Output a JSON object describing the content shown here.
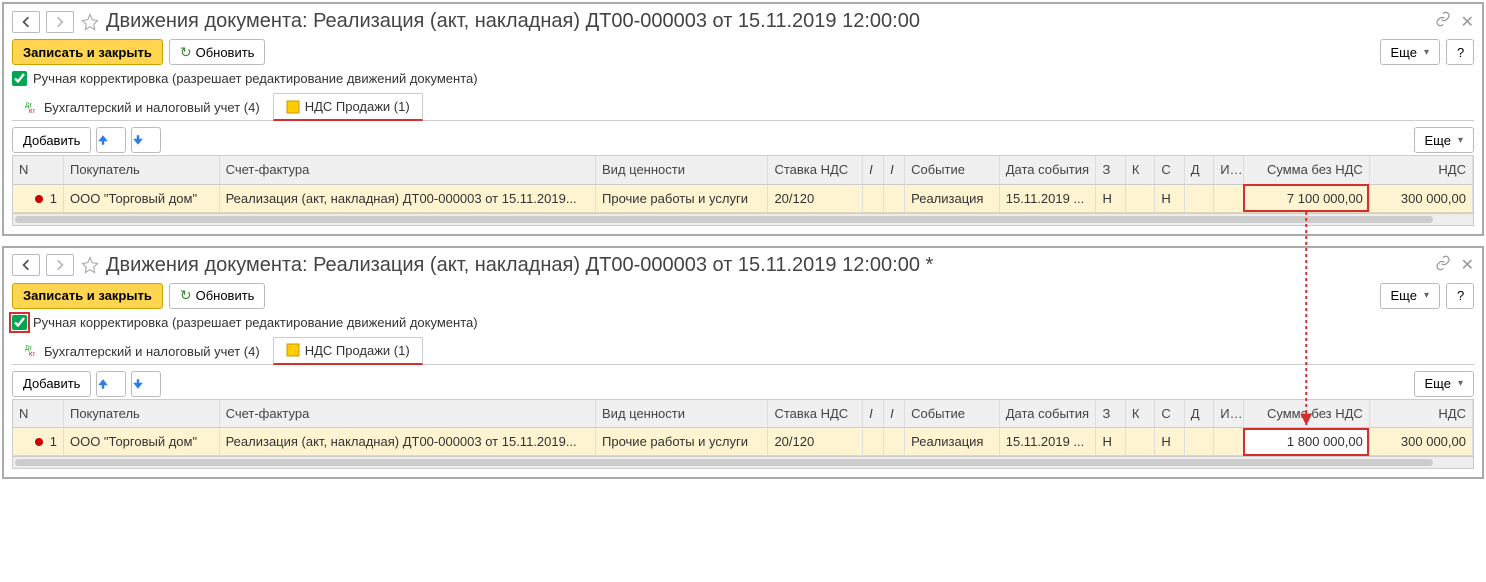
{
  "panel1": {
    "title": "Движения документа: Реализация (акт, накладная) ДТ00-000003 от 15.11.2019 12:00:00",
    "toolbar": {
      "save_close": "Записать и закрыть",
      "refresh": "Обновить",
      "more": "Еще",
      "help": "?"
    },
    "checkbox": {
      "label": "Ручная корректировка (разрешает редактирование движений документа)",
      "checked": true,
      "highlighted": false
    },
    "tabs": {
      "tab1": "Бухгалтерский и налоговый учет (4)",
      "tab2": "НДС Продажи (1)"
    },
    "subtoolbar": {
      "add": "Добавить",
      "more": "Еще"
    },
    "columns": {
      "n": "N",
      "buyer": "Покупатель",
      "invoice": "Счет-фактура",
      "valtype": "Вид ценности",
      "vatrate": "Ставка НДС",
      "event": "Событие",
      "evdate": "Дата события",
      "s1": "З",
      "s2": "К",
      "s3": "С",
      "s4": "Д",
      "s5": "И...",
      "sum": "Сумма без НДС",
      "vat": "НДС"
    },
    "row": {
      "n": "1",
      "buyer": "ООО \"Торговый дом\"",
      "invoice": "Реализация (акт, накладная) ДТ00-000003 от 15.11.2019...",
      "valtype": "Прочие работы и услуги",
      "vatrate": "20/120",
      "event": "Реализация",
      "evdate": "15.11.2019 ...",
      "s1": "Н",
      "s3": "Н",
      "sum": "7 100 000,00",
      "vat": "300 000,00"
    }
  },
  "panel2": {
    "title": "Движения документа: Реализация (акт, накладная) ДТ00-000003 от 15.11.2019 12:00:00 *",
    "toolbar": {
      "save_close": "Записать и закрыть",
      "refresh": "Обновить",
      "more": "Еще",
      "help": "?"
    },
    "checkbox": {
      "label": "Ручная корректировка (разрешает редактирование движений документа)",
      "checked": true,
      "highlighted": true
    },
    "tabs": {
      "tab1": "Бухгалтерский и налоговый учет (4)",
      "tab2": "НДС Продажи (1)"
    },
    "subtoolbar": {
      "add": "Добавить",
      "more": "Еще"
    },
    "columns": {
      "n": "N",
      "buyer": "Покупатель",
      "invoice": "Счет-фактура",
      "valtype": "Вид ценности",
      "vatrate": "Ставка НДС",
      "event": "Событие",
      "evdate": "Дата события",
      "s1": "З",
      "s2": "К",
      "s3": "С",
      "s4": "Д",
      "s5": "И...",
      "sum": "Сумма без НДС",
      "vat": "НДС"
    },
    "row": {
      "n": "1",
      "buyer": "ООО \"Торговый дом\"",
      "invoice": "Реализация (акт, накладная) ДТ00-000003 от 15.11.2019...",
      "valtype": "Прочие работы и услуги",
      "vatrate": "20/120",
      "event": "Реализация",
      "evdate": "15.11.2019 ...",
      "s1": "Н",
      "s3": "Н",
      "sum": "1 800 000,00",
      "vat": "300 000,00"
    }
  }
}
